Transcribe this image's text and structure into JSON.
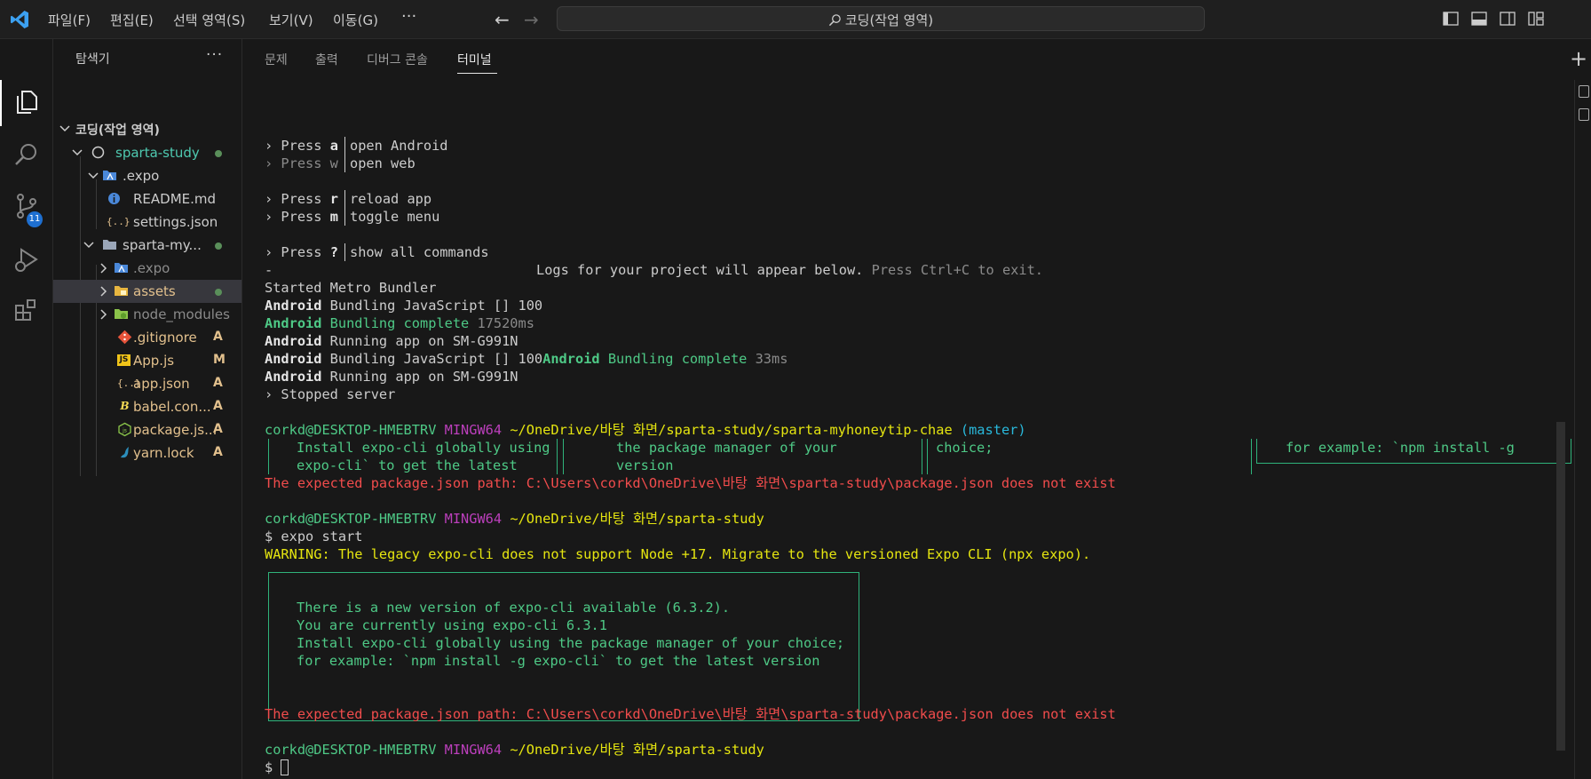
{
  "titlebar": {
    "menus": [
      "파일(F)",
      "편집(E)",
      "선택 영역(S)",
      "보기(V)",
      "이동(G)"
    ],
    "more": "···",
    "search": "코딩(작업 영역)"
  },
  "activity": {
    "scm_badge": "11"
  },
  "sidebar": {
    "title": "탐색기",
    "more": "···",
    "workspace": "코딩(작업 영역)",
    "items": [
      {
        "label": "sparta-study",
        "icon": "circle-icon",
        "status": "dot",
        "color": "#4ec9b0"
      },
      {
        "label": ".expo",
        "icon": "folder-expo-icon",
        "color": "#cccccc"
      },
      {
        "label": "README.md",
        "icon": "info-icon",
        "color": "#cccccc"
      },
      {
        "label": "settings.json",
        "icon": "json-icon",
        "color": "#cccccc"
      },
      {
        "label": "sparta-my...",
        "icon": "folder-icon",
        "status": "dot",
        "color": "#cccccc"
      },
      {
        "label": ".expo",
        "icon": "folder-expo-icon",
        "color": "#8b8b8b"
      },
      {
        "label": "assets",
        "icon": "folder-assets-icon",
        "status": "dot",
        "color": "#e2c08d"
      },
      {
        "label": "node_modules",
        "icon": "folder-node-icon",
        "color": "#8b8b8b"
      },
      {
        "label": ".gitignore",
        "icon": "git-icon",
        "status": "A",
        "color": "#e2c08d"
      },
      {
        "label": "App.js",
        "icon": "js-icon",
        "status": "M",
        "color": "#e2c08d"
      },
      {
        "label": "app.json",
        "icon": "json-icon",
        "status": "A",
        "color": "#e2c08d"
      },
      {
        "label": "babel.con...",
        "icon": "babel-icon",
        "status": "A",
        "color": "#e2c08d"
      },
      {
        "label": "package.js...",
        "icon": "nodejs-icon",
        "status": "A",
        "color": "#e2c08d"
      },
      {
        "label": "yarn.lock",
        "icon": "yarn-icon",
        "status": "A",
        "color": "#e2c08d"
      }
    ]
  },
  "panel": {
    "tabs": [
      "문제",
      "출력",
      "디버그 콘솔",
      "터미널"
    ],
    "active_tab": "터미널"
  },
  "terminal": {
    "press_a": "› Press ",
    "key_a": "a",
    "cmd_a": "open Android",
    "press_w": "› Press w",
    "cmd_w": "open web",
    "press_r": "› Press ",
    "key_r": "r",
    "cmd_r": "reload app",
    "press_m": "› Press ",
    "key_m": "m",
    "cmd_m": "toggle menu",
    "press_q": "› Press ",
    "key_q": "?",
    "cmd_q": "show all commands",
    "dash": "-",
    "logs_msg": "Logs for your project will appear below.",
    "logs_exit": "Press Ctrl+C to exit.",
    "started": "Started Metro Bundler",
    "android": "Android",
    "bundling_js": " Bundling JavaScript [] 100",
    "bundling_complete": " Bundling complete",
    "t1": " 17520ms",
    "running": " Running app on SM-G991N",
    "bundling_js2": " Bundling JavaScript [] 100",
    "t2": " 33ms",
    "stopped": "› Stopped server",
    "user": "corkd@DESKTOP-HMEBTRV",
    "mingw": "MINGW64",
    "path1": "~/OneDrive/바탕 화면/sparta-study/sparta-myhoneytip-chae",
    "branch": "(master)",
    "col1a": "Install expo-cli globally using",
    "col1b": "expo-cli` to get the latest",
    "col2a": "the package manager of your",
    "col2b": "version",
    "col3a": "choice;",
    "col4a": "for example: `npm install -g",
    "err1": "The expected package.json path: C:\\Users\\corkd\\OneDrive\\바탕 화면\\sparta-study\\package.json does not exist",
    "path2": "~/OneDrive/바탕 화면/sparta-study",
    "cmd": "$ expo start",
    "warning": "WARNING: The legacy expo-cli does not support Node +17. Migrate to the versioned Expo CLI (npx expo).",
    "box1": "There is a new version of expo-cli available (6.3.2).",
    "box2": "You are currently using expo-cli 6.3.1",
    "box3": "Install expo-cli globally using the package manager of your choice;",
    "box4": "for example: `npm install -g expo-cli` to get the latest version",
    "err2": "The expected package.json path: C:\\Users\\corkd\\OneDrive\\바탕 화면\\sparta-study\\package.json does not exist",
    "path3": "~/OneDrive/바탕 화면/sparta-study",
    "prompt": "$ "
  }
}
